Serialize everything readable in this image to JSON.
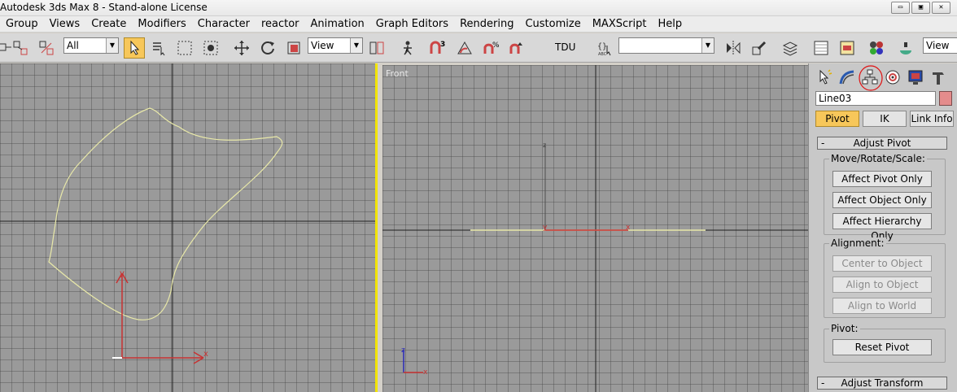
{
  "window": {
    "title": "Autodesk 3ds Max 8  - Stand-alone License",
    "buttons": [
      "▭",
      "▣",
      "✕"
    ]
  },
  "menu": [
    "Group",
    "Views",
    "Create",
    "Modifiers",
    "Character",
    "reactor",
    "Animation",
    "Graph Editors",
    "Rendering",
    "Customize",
    "MAXScript",
    "Help"
  ],
  "toolbar": {
    "selection_filter": "All",
    "reference_coord": "View",
    "tdu_label": "TDU",
    "named_selection": "",
    "right_combo": "View",
    "snap_value": "3"
  },
  "viewports": {
    "front_label": "Front",
    "axis_x": "x",
    "axis_y": "y",
    "axis_z": "z"
  },
  "command_panel": {
    "object_name": "Line03",
    "object_color": "#e48c8c",
    "tabs": [
      "create-icon",
      "modify-icon",
      "hierarchy-icon",
      "motion-icon",
      "display-icon",
      "utilities-icon"
    ],
    "mode_buttons": [
      "Pivot",
      "IK",
      "Link Info"
    ],
    "active_mode": "Pivot",
    "adjust_pivot": {
      "title": "Adjust Pivot",
      "move_group": "Move/Rotate/Scale:",
      "move_buttons": [
        "Affect Pivot Only",
        "Affect Object Only",
        "Affect Hierarchy Only"
      ],
      "alignment_group": "Alignment:",
      "alignment_buttons": [
        "Center to Object",
        "Align to Object",
        "Align to World"
      ],
      "pivot_group": "Pivot:",
      "pivot_button": "Reset Pivot"
    },
    "adjust_transform_title": "Adjust Transform",
    "rollout_toggle": "-"
  },
  "colors": {
    "accent_active": "#f7c75a",
    "viewport_bg": "#9a9a9a",
    "spline": "#e8e8a8",
    "axis_red": "#c83232",
    "active_border": "#f2e400",
    "annotation": "#e01010"
  }
}
